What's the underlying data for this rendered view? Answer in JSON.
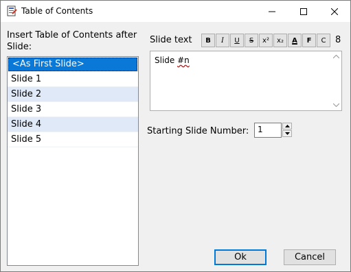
{
  "window": {
    "title": "Table of Contents"
  },
  "left": {
    "label": "Insert Table of Contents after Slide:",
    "slides": [
      "<As First Slide>",
      "Slide 1",
      "Slide 2",
      "Slide 3",
      "Slide 4",
      "Slide 5"
    ],
    "selected_index": 0
  },
  "editor": {
    "label": "Slide text",
    "format_buttons": [
      {
        "name": "bold-button",
        "glyph": "B"
      },
      {
        "name": "italic-button",
        "glyph": "I"
      },
      {
        "name": "underline-button",
        "glyph": "U"
      },
      {
        "name": "strikethrough-button",
        "glyph": "S"
      },
      {
        "name": "superscript-button",
        "glyph": "x²"
      },
      {
        "name": "subscript-button",
        "glyph": "x₂"
      },
      {
        "name": "font-color-button",
        "glyph": "A"
      },
      {
        "name": "font-button",
        "glyph": "F"
      },
      {
        "name": "case-button",
        "glyph": "C"
      }
    ],
    "font_size": "8",
    "text_prefix": "Slide ",
    "text_token": "#n"
  },
  "start": {
    "label": "Starting Slide Number:",
    "value": "1"
  },
  "buttons": {
    "ok": "Ok",
    "cancel": "Cancel"
  },
  "colors": {
    "selection": "#0a78d7",
    "alt_row": "#dfe9f7",
    "accent": "#0078d7"
  }
}
